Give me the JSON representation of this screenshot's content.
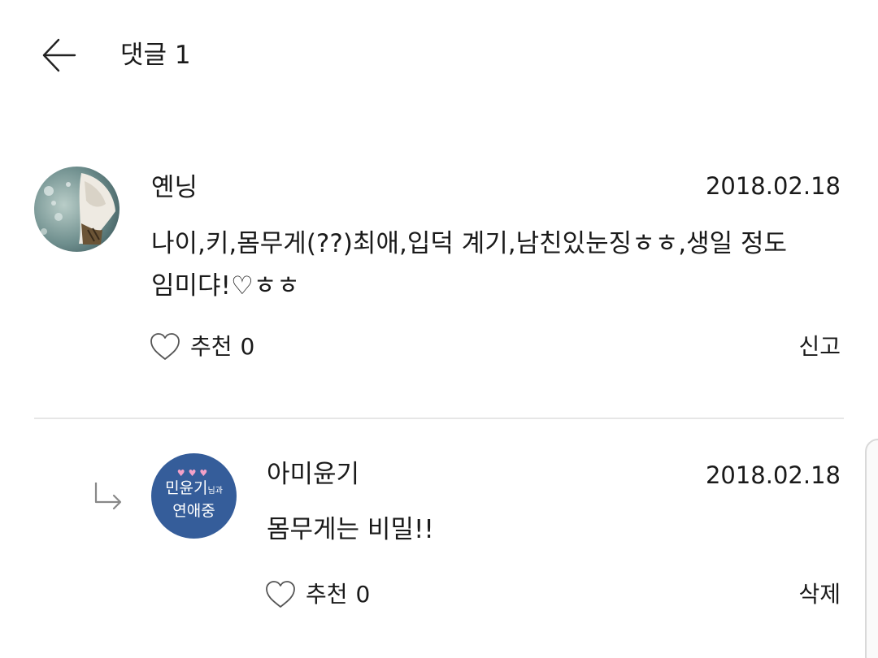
{
  "header": {
    "title": "댓글 1"
  },
  "comments": [
    {
      "author": "옌닝",
      "date": "2018.02.18",
      "text_line1": "나이,키,몸무게(??)최애,입덕 계기,남친있눈징ㅎㅎ,생일 정도",
      "text_line2": "임미댜!♡ㅎㅎ",
      "like_label": "추천",
      "like_count": "0",
      "action": "신고"
    },
    {
      "author": "아미윤기",
      "date": "2018.02.18",
      "text_line1": "몸무게는 비밀!!",
      "like_label": "추천",
      "like_count": "0",
      "action": "삭제",
      "badge": {
        "hearts": "♥♥♥",
        "line1_main": "민윤기",
        "line1_small": "님과",
        "line2": "연애중"
      }
    }
  ],
  "colors": {
    "badge_bg": "#355d9a",
    "badge_hearts": "#f3a1c8",
    "divider": "#e6e6e6",
    "text": "#1a1a1a"
  },
  "icons": {
    "back": "arrow-left-icon",
    "like": "heart-outline-icon",
    "reply": "reply-arrow-icon"
  }
}
